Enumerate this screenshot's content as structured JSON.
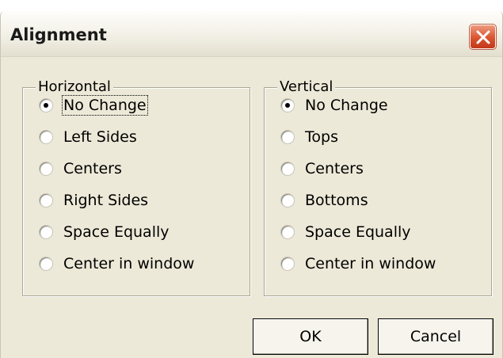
{
  "dialog": {
    "title": "Alignment",
    "close_icon": "close-icon"
  },
  "horizontal": {
    "legend": "Horizontal",
    "options": [
      "No Change",
      "Left Sides",
      "Centers",
      "Right Sides",
      "Space Equally",
      "Center in window"
    ],
    "selected": "No Change"
  },
  "vertical": {
    "legend": "Vertical",
    "options": [
      "No Change",
      "Tops",
      "Centers",
      "Bottoms",
      "Space Equally",
      "Center in window"
    ],
    "selected": "No Change"
  },
  "buttons": {
    "ok": "OK",
    "cancel": "Cancel"
  }
}
